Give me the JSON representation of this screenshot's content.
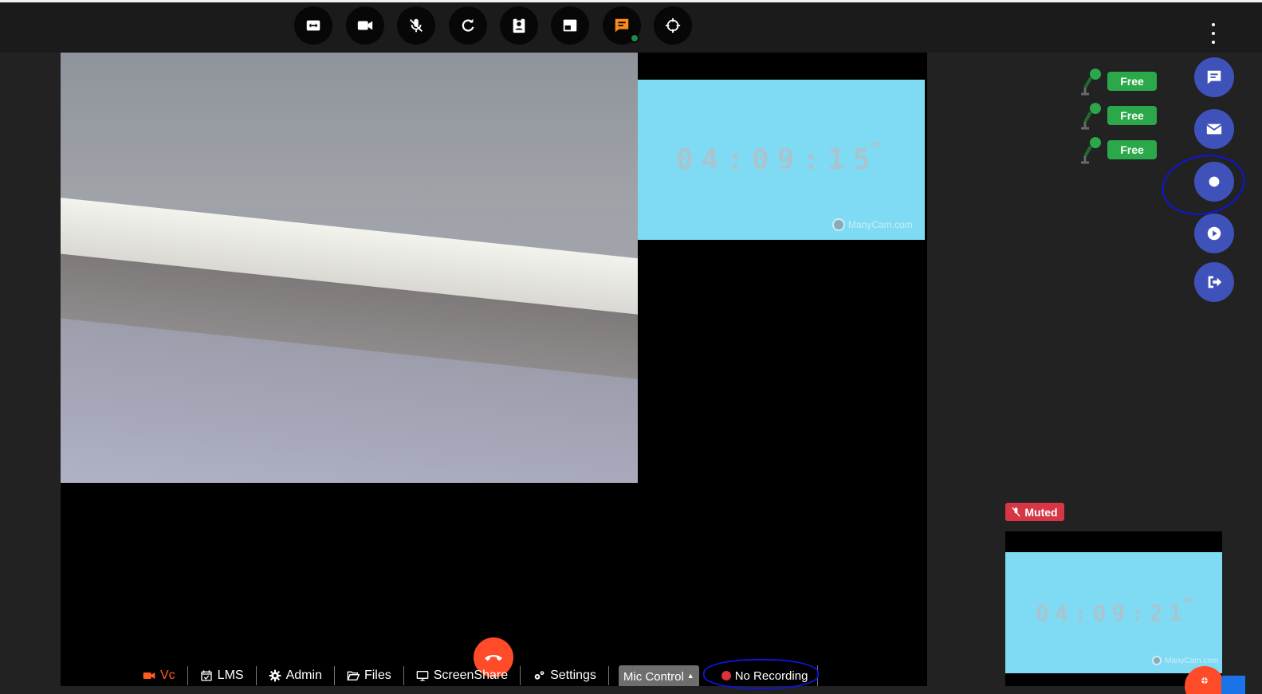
{
  "toolbar": {
    "buttons": [
      {
        "name": "fit-screen-button",
        "icon": "fit-screen-icon"
      },
      {
        "name": "camera-button",
        "icon": "video-camera-icon"
      },
      {
        "name": "mic-button",
        "icon": "mic-off-icon"
      },
      {
        "name": "refresh-button",
        "icon": "refresh-icon"
      },
      {
        "name": "contact-button",
        "icon": "contact-card-icon"
      },
      {
        "name": "layout-button",
        "icon": "layout-icon"
      },
      {
        "name": "chat-button",
        "icon": "chat-icon",
        "active_color": "#ff8a1c"
      },
      {
        "name": "target-button",
        "icon": "target-icon"
      }
    ]
  },
  "main_video": {
    "remote_clock": "04:09:15",
    "remote_ampm": "PM",
    "watermark": "ManyCam.com"
  },
  "bottom_nav": {
    "items": [
      {
        "label": "Vc",
        "icon": "video-camera-icon",
        "active": true
      },
      {
        "label": "LMS",
        "icon": "calendar-check-icon"
      },
      {
        "label": "Admin",
        "icon": "gear-icon"
      },
      {
        "label": "Files",
        "icon": "folder-open-icon"
      },
      {
        "label": "ScreenShare",
        "icon": "monitor-icon"
      },
      {
        "label": "Settings",
        "icon": "gears-icon"
      }
    ],
    "mic_control_label": "Mic Control",
    "recording_label": "No Recording"
  },
  "mic_slots": [
    {
      "status": "Free"
    },
    {
      "status": "Free"
    },
    {
      "status": "Free"
    }
  ],
  "side_actions": [
    {
      "name": "chat-action",
      "icon": "message-icon"
    },
    {
      "name": "mail-action",
      "icon": "envelope-icon"
    },
    {
      "name": "record-action",
      "icon": "record-icon"
    },
    {
      "name": "play-action",
      "icon": "play-icon"
    },
    {
      "name": "exit-action",
      "icon": "sign-out-icon"
    }
  ],
  "self_view": {
    "status": "Muted",
    "clock": "04:09:21",
    "ampm": "PM",
    "watermark": "ManyCam.com"
  },
  "colors": {
    "accent_orange": "#ff4b27",
    "side_button_blue": "#3f52ba",
    "free_green": "#2ba84a",
    "muted_red": "#d73645",
    "annotation_blue": "#0d16d8"
  }
}
